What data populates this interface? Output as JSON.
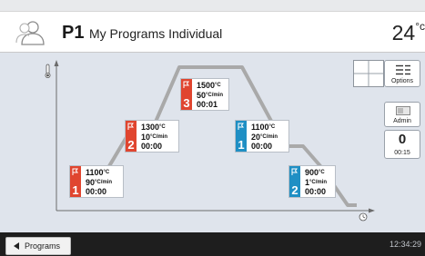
{
  "header": {
    "program_id": "P1",
    "program_name": "My Programs Individual",
    "temperature_value": "24",
    "temperature_unit": "°c"
  },
  "steps": [
    {
      "kind": "heat",
      "number": "1",
      "temp": "1100",
      "rate": "90",
      "time": "00:00"
    },
    {
      "kind": "heat",
      "number": "2",
      "temp": "1300",
      "rate": "10",
      "time": "00:00"
    },
    {
      "kind": "heat",
      "number": "3",
      "temp": "1500",
      "rate": "50",
      "time": "00:01"
    },
    {
      "kind": "cool",
      "number": "1",
      "temp": "1100",
      "rate": "20",
      "time": "00:00"
    },
    {
      "kind": "cool",
      "number": "2",
      "temp": "900",
      "rate": "1",
      "time": "00:00"
    }
  ],
  "units": {
    "temp": "°C",
    "rate": "°C/min"
  },
  "controls": {
    "options_label": "Options",
    "admin_label": "Admin",
    "counter_value": "0",
    "counter_time": "00:15"
  },
  "footer": {
    "programs_label": "Programs",
    "clock": "12:34:29"
  },
  "icons": [
    "user-icon",
    "thermometer-icon",
    "clock-icon",
    "menu-icon",
    "admin-icon",
    "flag-icon",
    "back-arrow-icon"
  ],
  "colors": {
    "heat": "#e0452f",
    "cool": "#1f8fc4",
    "curve": "#a9a9a9"
  }
}
